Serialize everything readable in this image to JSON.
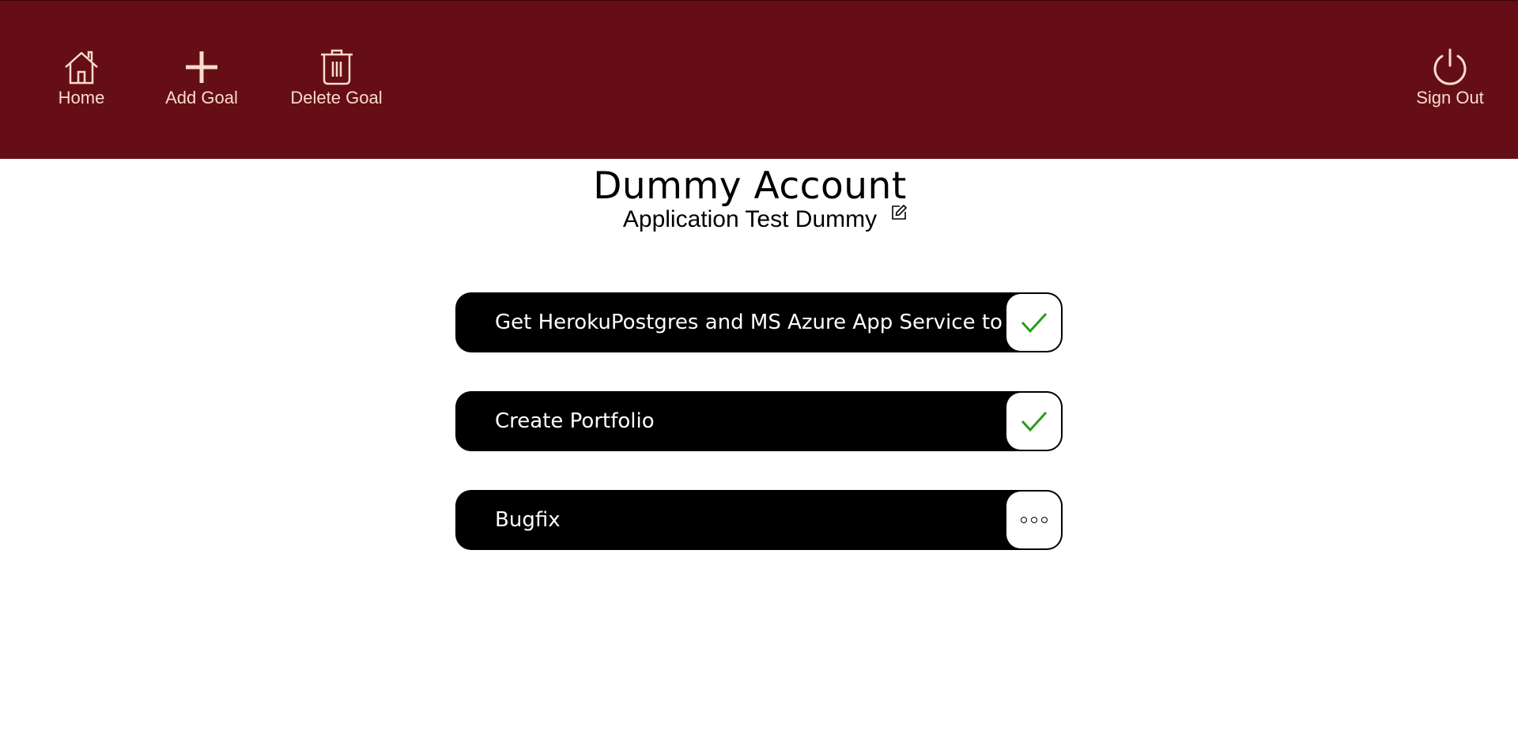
{
  "nav": {
    "home_label": "Home",
    "add_goal_label": "Add Goal",
    "delete_goal_label": "Delete Goal",
    "sign_out_label": "Sign Out"
  },
  "account": {
    "title": "Dummy Account",
    "subtitle": "Application Test Dummy"
  },
  "goals": [
    {
      "text": "Get HerokuPostgres and MS Azure App Service to Run",
      "status": "complete",
      "status_icon": "checkmark-icon"
    },
    {
      "text": "Create Portfolio",
      "status": "complete",
      "status_icon": "checkmark-icon"
    },
    {
      "text": "Bugfix",
      "status": "in-progress",
      "status_icon": "ellipsis-icon"
    }
  ],
  "colors": {
    "navbar": "#650e16",
    "nav_text": "#f9dccb",
    "goal_bg": "#000000",
    "check": "#2a9d1c"
  }
}
